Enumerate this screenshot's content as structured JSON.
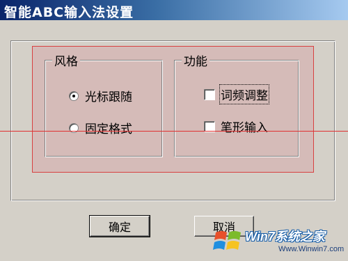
{
  "window": {
    "title": "智能ABC输入法设置"
  },
  "style_group": {
    "legend": "风格",
    "options": [
      {
        "label": "光标跟随",
        "selected": true
      },
      {
        "label": "固定格式",
        "selected": false
      }
    ]
  },
  "function_group": {
    "legend": "功能",
    "options": [
      {
        "label": "词频调整",
        "checked": false,
        "focused": true
      },
      {
        "label": "笔形输入",
        "checked": false,
        "focused": false
      }
    ]
  },
  "buttons": {
    "ok": "确定",
    "cancel": "取消"
  },
  "watermark": {
    "name": "Win7系统之家",
    "url": "Www.Winwin7.com"
  },
  "colors": {
    "title_bar_start": "#0a246a",
    "title_bar_end": "#a6caf0",
    "dialog_face": "#d4d0c8",
    "highlight_fill": "#d5bbb8",
    "highlight_border": "#d84040"
  }
}
